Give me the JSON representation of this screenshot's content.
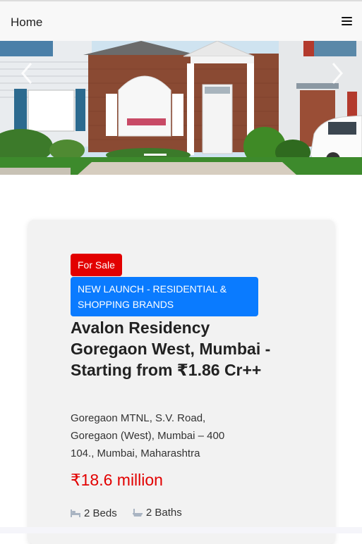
{
  "nav": {
    "home_label": "Home",
    "menu_icon": "hamburger-menu-icon"
  },
  "hero": {
    "prev_icon": "chevron-left-icon",
    "next_icon": "chevron-right-icon"
  },
  "listing": {
    "status_badge": "For Sale",
    "category_badge": "NEW LAUNCH - RESIDENTIAL & SHOPPING BRANDS",
    "title": "Avalon Residency Goregaon West, Mumbai - Starting from ₹1.86 Cr++",
    "address": "Goregaon MTNL, S.V. Road, Goregaon (West), Mumbai – 400 104., Mumbai, Maharashtra",
    "price": "₹18.6 million",
    "beds": "2 Beds",
    "baths": "2 Baths",
    "beds_icon": "bed-icon",
    "baths_icon": "bathtub-icon"
  },
  "colors": {
    "sale_badge": "#e20000",
    "launch_badge": "#0a7bff",
    "price": "#e20000",
    "card_bg": "#f2f2f2"
  }
}
